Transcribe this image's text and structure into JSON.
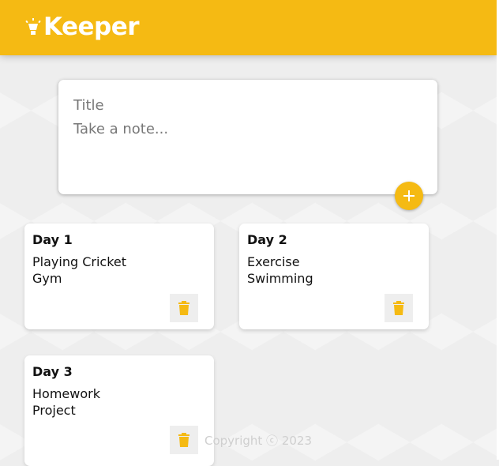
{
  "header": {
    "app_name": "Keeper",
    "logo_icon": "lightbulb-icon"
  },
  "create_note": {
    "title_placeholder": "Title",
    "content_placeholder": "Take a note...",
    "add_icon": "plus-icon"
  },
  "notes": [
    {
      "title": "Day 1",
      "content": "Playing Cricket\nGym"
    },
    {
      "title": "Day 2",
      "content": "Exercise\nSwimming"
    },
    {
      "title": "Day 3",
      "content": "Homework\nProject"
    }
  ],
  "footer": {
    "text": "Copyright ⓒ 2023"
  },
  "colors": {
    "brand": "#f5ba13",
    "background": "#eeeeee",
    "card": "#ffffff"
  }
}
